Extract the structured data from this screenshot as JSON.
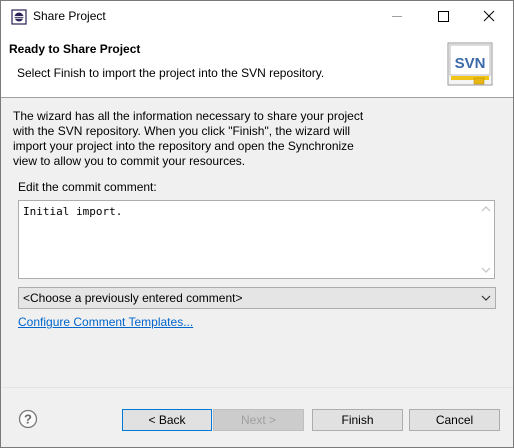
{
  "window": {
    "title": "Share Project"
  },
  "header": {
    "title": "Ready to Share Project",
    "description": "Select Finish to import the project into the SVN repository.",
    "logo_text": "SVN"
  },
  "body": {
    "info": "The wizard has all the information necessary to share your project with the SVN repository. When you click \"Finish\", the wizard will import your project into the repository and open the Synchronize view to allow you to commit your resources.",
    "commit_label": "Edit the commit comment:",
    "commit_comment": "Initial import.",
    "previous_comment_select": "<Choose a previously entered comment>",
    "configure_link": "Configure Comment Templates..."
  },
  "buttons": {
    "back": "< Back",
    "next": "Next >",
    "finish": "Finish",
    "cancel": "Cancel"
  }
}
